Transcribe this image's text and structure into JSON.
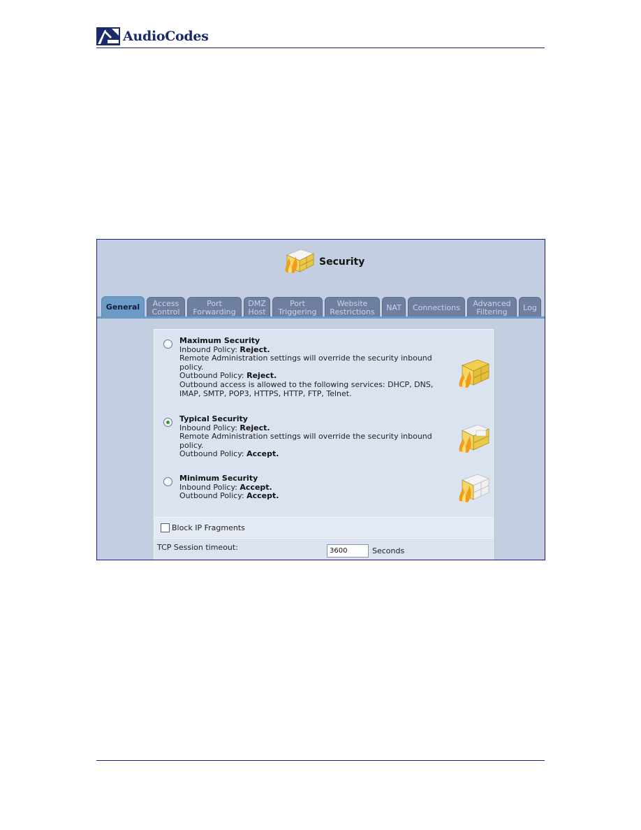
{
  "document": {
    "brand": "AudioCodes"
  },
  "window": {
    "title": "Security",
    "title_icon": "firewall-icon"
  },
  "tabs": [
    {
      "label": "General",
      "active": true
    },
    {
      "label": "Access\nControl",
      "active": false
    },
    {
      "label": "Port\nForwarding",
      "active": false
    },
    {
      "label": "DMZ\nHost",
      "active": false
    },
    {
      "label": "Port\nTriggering",
      "active": false
    },
    {
      "label": "Website\nRestrictions",
      "active": false
    },
    {
      "label": "NAT",
      "active": false
    },
    {
      "label": "Connections",
      "active": false
    },
    {
      "label": "Advanced\nFiltering",
      "active": false
    },
    {
      "label": "Log",
      "active": false
    }
  ],
  "security_levels": {
    "selected": "Typical Security",
    "options": [
      {
        "title": "Maximum Security",
        "inbound_label": "Inbound Policy: ",
        "inbound_value": "Reject.",
        "note": "Remote Administration settings will override the security inbound policy.",
        "outbound_label": "Outbound Policy: ",
        "outbound_value": "Reject.",
        "services": "Outbound access is allowed to the following services: DHCP, DNS, IMAP, SMTP, POP3, HTTPS, HTTP, FTP, Telnet.",
        "checked": false,
        "icon": "firewall-max-icon"
      },
      {
        "title": "Typical Security",
        "inbound_label": "Inbound Policy: ",
        "inbound_value": "Reject.",
        "note": "Remote Administration settings will override the security inbound policy.",
        "outbound_label": "Outbound Policy: ",
        "outbound_value": "Accept.",
        "checked": true,
        "icon": "firewall-typical-icon"
      },
      {
        "title": "Minimum Security",
        "inbound_label": "Inbound Policy: ",
        "inbound_value": "Accept.",
        "outbound_label": "Outbound Policy: ",
        "outbound_value": "Accept.",
        "checked": false,
        "icon": "firewall-min-icon"
      }
    ]
  },
  "block_ip_fragments": {
    "label": "Block IP Fragments",
    "checked": false
  },
  "tcp_session": {
    "label": "TCP Session timeout:",
    "value": "3600",
    "unit": "Seconds"
  },
  "colors": {
    "frame_bg": "#c3cfe0",
    "active_tab": "#6d9bc8",
    "inactive_tab": "#6f7fa0",
    "panel_bg": "#dbe3f0",
    "rule": "#1a237e"
  }
}
